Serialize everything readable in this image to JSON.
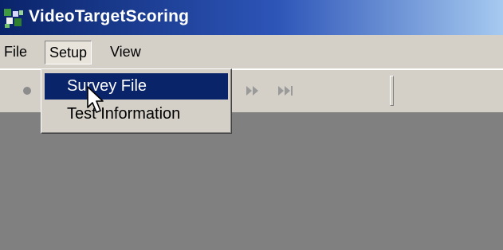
{
  "window": {
    "title": "VideoTargetScoring"
  },
  "menubar": {
    "items": [
      {
        "label": "File"
      },
      {
        "label": "Setup"
      },
      {
        "label": "View"
      }
    ]
  },
  "dropdown": {
    "parent": "Setup",
    "items": [
      {
        "label": "Survey File",
        "highlighted": true
      },
      {
        "label": "Test Information",
        "highlighted": false
      }
    ]
  },
  "toolbar": {
    "icons": [
      "record-icon",
      "fast-forward-icon",
      "skip-to-end-icon"
    ]
  },
  "colors": {
    "title_bar_start": "#0a246a",
    "title_bar_end": "#a6caf0",
    "chrome": "#d4d0c8",
    "client_area": "#808080",
    "highlight": "#0a246a",
    "highlight_text": "#ffffff"
  }
}
